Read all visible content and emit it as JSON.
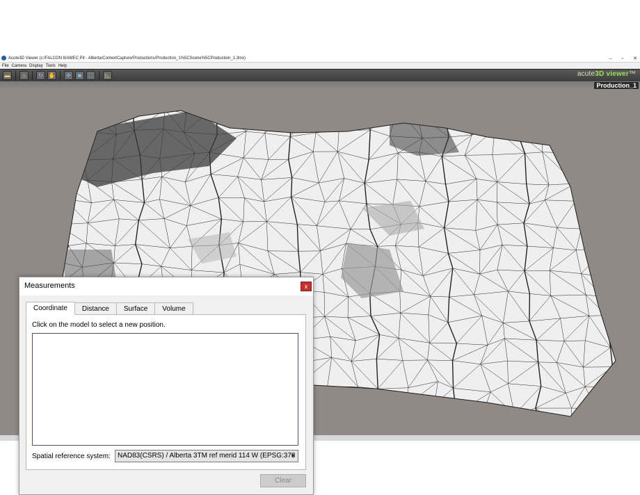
{
  "window": {
    "title": "Acute3D Viewer (c:/FALCON 8/AMEC Pit - Alberta/ContextCapture/Productions/Production_1%5CScene%5CProduction_1.3mx)",
    "controls": {
      "minimize": "–",
      "maximize": "▫",
      "close": "✕"
    }
  },
  "menu": {
    "items": [
      "File",
      "Camera",
      "Display",
      "Tools",
      "Help"
    ]
  },
  "toolbar": {
    "brand_prefix": "acute",
    "brand_main": "3D viewer",
    "brand_tm": "™",
    "icons": [
      "open-folder-icon",
      "home-icon",
      "orbit-icon",
      "pan-hand-icon",
      "measure-points-icon",
      "snapshot-icon",
      "fullscreen-icon",
      "ruler-icon"
    ]
  },
  "viewport": {
    "scene_label": "Production_1"
  },
  "colors": {
    "background": "#8f8a86",
    "brand": "#9be05a",
    "dialog_close": "#c8302c"
  },
  "dialog": {
    "title": "Measurements",
    "close": "x",
    "tabs": [
      {
        "label": "Coordinate",
        "active": true
      },
      {
        "label": "Distance",
        "active": false
      },
      {
        "label": "Surface",
        "active": false
      },
      {
        "label": "Volume",
        "active": false
      }
    ],
    "instruction": "Click on the model to select a new position.",
    "srs_label": "Spatial reference system:",
    "srs_value": "NAD83(CSRS) / Alberta 3TM ref merid 114 W (EPSG:378",
    "clear_label": "Clear"
  }
}
